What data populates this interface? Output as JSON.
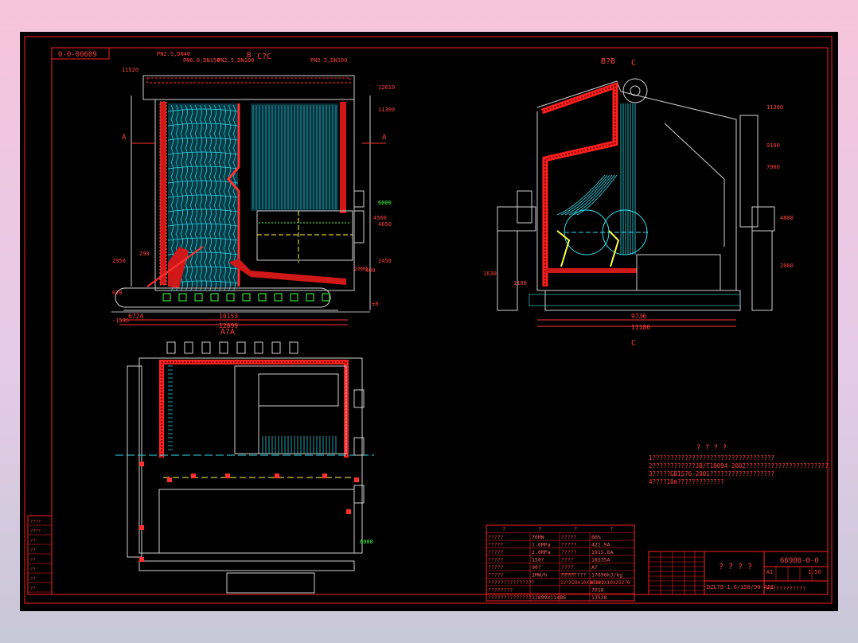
{
  "drawing": {
    "drawing_no_top": "0-0-00609",
    "view_labels": {
      "section_cc": "C?C",
      "section_bb": "B?B",
      "section_aa": "A?A",
      "mark_a_left": "A",
      "mark_a_right": "A",
      "mark_b": "B",
      "mark_c_top": "C",
      "mark_c_bottom": "C"
    },
    "front_view": {
      "pipe_notes": [
        "PN2.5,DN40",
        "PN6.0,DN150",
        "PN2.5,DN100",
        "PN2.5,DN100"
      ],
      "elev_left": [
        "11520",
        "2950",
        "290",
        "620",
        "-1535"
      ],
      "elev_right": [
        "12610",
        "11300",
        "6000",
        "4560",
        "4650",
        "2450",
        "2000",
        "400",
        "±0"
      ],
      "dims_bottom": [
        "6724",
        "10153",
        "12899"
      ]
    },
    "side_view": {
      "elev_right": [
        "11300",
        "9100",
        "7900",
        "4800",
        "2000"
      ],
      "elev_left": [
        "1630",
        "1100"
      ],
      "dims_bottom": [
        "9736",
        "11186"
      ]
    },
    "plan_view": {
      "elev_right": [
        "6000"
      ]
    },
    "notes": {
      "title": "? ? ? ?",
      "lines": [
        "1??????????????????????????????????",
        "2????????????JB/T10094-2002???????????????????????",
        "3?????GB1576-2001??????????????????",
        "4????10m?????????????"
      ]
    },
    "spec_table": {
      "header": [
        "?",
        "?",
        "?",
        "?"
      ],
      "rows": [
        [
          "?????",
          "70MW",
          "?????",
          "80%"
        ],
        [
          "?????",
          "1.6MPa",
          "?????",
          "421.9A"
        ],
        [
          "?????",
          "2.0MPa",
          "?????",
          "1915.6A"
        ],
        [
          "?????",
          "150?",
          "????",
          "18535A"
        ],
        [
          "?????",
          "90?",
          "????",
          "A?"
        ],
        [
          "?????",
          "1MW/h",
          "????????",
          "17690kJ/kg"
        ],
        [
          "???????????????",
          "",
          "",
          ""
        ],
        [
          "????????",
          "",
          "",
          "7018"
        ],
        [
          "??????????????",
          "12899X11486",
          "",
          "13520"
        ]
      ],
      "extra_cells": [
        "12?X29X10X3624?",
        "?????",
        "4?X22X10X25270"
      ]
    },
    "title_block": {
      "drawing_no": "66900-0-0",
      "name": "? ? ? ?",
      "model": "DZL70-1.6/150/90-AII",
      "scale": "1:50",
      "sheet_text": "????????????",
      "code": "A1"
    },
    "revision_block": [
      "????",
      "????",
      "??",
      "??",
      "??",
      "??",
      "??",
      "??"
    ]
  }
}
